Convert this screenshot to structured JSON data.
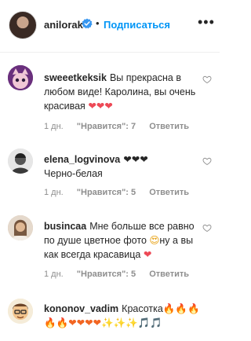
{
  "post": {
    "username": "anilorak",
    "follow_label": "Подписаться",
    "separator": "•",
    "more": "•••"
  },
  "comments": [
    {
      "username": "sweeetkeksik",
      "text": "Вы прекрасна в любом виде! Каролина, вы очень красивая",
      "emoji": "❤❤❤",
      "time": "1 дн.",
      "likes": "\"Нравится\": 7",
      "reply": "Ответить"
    },
    {
      "username": "elena_logvinova",
      "text": "",
      "emoji": "❤❤❤",
      "text_after": "Черно-белая",
      "time": "1 дн.",
      "likes": "\"Нравится\": 5",
      "reply": "Ответить"
    },
    {
      "username": "busincaa",
      "text": "Мне больше все равно по душе цветное фото",
      "emoji": "😍",
      "text_after": "ну а вы как всегда красавица",
      "emoji2": "❤",
      "time": "1 дн.",
      "likes": "\"Нравится\": 5",
      "reply": "Ответить"
    },
    {
      "username": "kononov_vadim",
      "text": "Красотка",
      "emoji": "🔥🔥🔥",
      "emoji2": "🔥🔥❤❤❤❤",
      "emoji3": "✨✨✨",
      "emoji4": "🎵🎵",
      "time": "",
      "likes": "",
      "reply": ""
    }
  ]
}
